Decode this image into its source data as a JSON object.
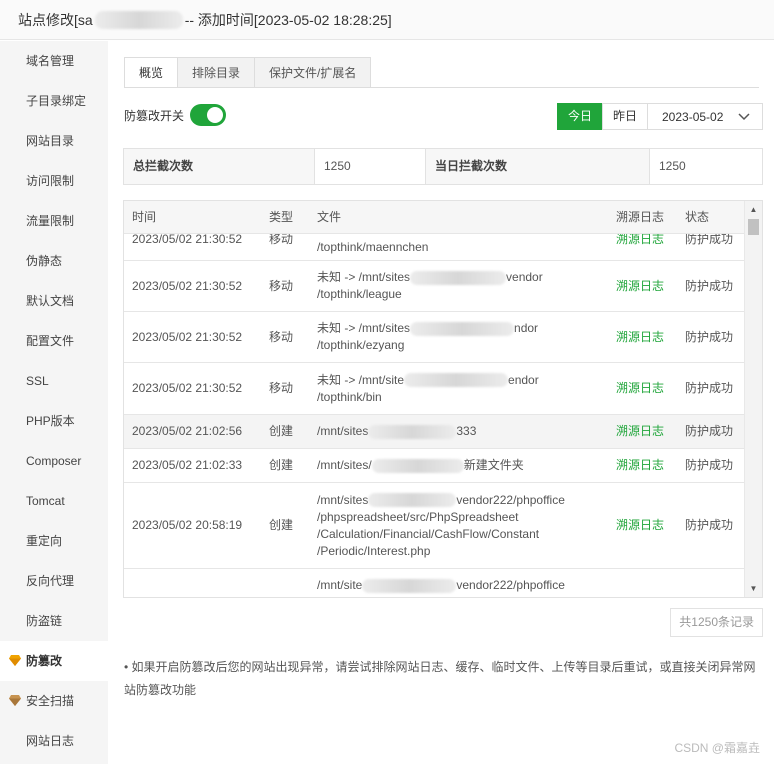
{
  "titlebar": {
    "prefix": "站点修改[sa",
    "suffix": "-- 添加时间[2023-05-02 18:28:25]"
  },
  "sidebar": {
    "items": [
      {
        "label": "域名管理"
      },
      {
        "label": "子目录绑定"
      },
      {
        "label": "网站目录"
      },
      {
        "label": "访问限制"
      },
      {
        "label": "流量限制"
      },
      {
        "label": "伪静态"
      },
      {
        "label": "默认文档"
      },
      {
        "label": "配置文件"
      },
      {
        "label": "SSL"
      },
      {
        "label": "PHP版本"
      },
      {
        "label": "Composer"
      },
      {
        "label": "Tomcat"
      },
      {
        "label": "重定向"
      },
      {
        "label": "反向代理"
      },
      {
        "label": "防盗链"
      },
      {
        "label": "防篡改"
      },
      {
        "label": "安全扫描"
      },
      {
        "label": "网站日志"
      }
    ],
    "active_label": "防篡改"
  },
  "tabs": [
    {
      "label": "概览"
    },
    {
      "label": "排除目录"
    },
    {
      "label": "保护文件/扩展名"
    }
  ],
  "toggle": {
    "label": "防篡改开关",
    "on": true
  },
  "datebar": {
    "today": "今日",
    "yesterday": "昨日",
    "date": "2023-05-02"
  },
  "stats": {
    "total_label": "总拦截次数",
    "total_value": "1250",
    "today_label": "当日拦截次数",
    "today_value": "1250"
  },
  "table": {
    "headers": {
      "time": "时间",
      "type": "类型",
      "file": "文件",
      "log": "溯源日志",
      "status": "状态"
    },
    "rows": [
      {
        "time": "2023/05/02 21:30:52",
        "type": "移动",
        "file": [
          "/topthink/maennchen"
        ],
        "log": "溯源日志",
        "status": "防护成功"
      },
      {
        "time": "2023/05/02 21:30:52",
        "type": "移动",
        "file": [
          "未知 -> /mnt/sites",
          "vendor",
          "/topthink/league"
        ],
        "log": "溯源日志",
        "status": "防护成功"
      },
      {
        "time": "2023/05/02 21:30:52",
        "type": "移动",
        "file": [
          "未知 -> /mnt/sites",
          "ndor",
          "/topthink/ezyang"
        ],
        "log": "溯源日志",
        "status": "防护成功"
      },
      {
        "time": "2023/05/02 21:30:52",
        "type": "移动",
        "file": [
          "未知 -> /mnt/site",
          "endor",
          "/topthink/bin"
        ],
        "log": "溯源日志",
        "status": "防护成功"
      },
      {
        "time": "2023/05/02 21:02:56",
        "type": "创建",
        "file": [
          "/mnt/sites",
          "333"
        ],
        "log": "溯源日志",
        "status": "防护成功"
      },
      {
        "time": "2023/05/02 21:02:33",
        "type": "创建",
        "file": [
          "/mnt/sites/",
          "新建文件夹"
        ],
        "log": "溯源日志",
        "status": "防护成功"
      },
      {
        "time": "2023/05/02 20:58:19",
        "type": "创建",
        "file": [
          "/mnt/sites",
          "vendor222/phpoffice",
          "/phpspreadsheet/src/PhpSpreadsheet",
          "/Calculation/Financial/CashFlow/Constant",
          "/Periodic/Interest.php"
        ],
        "log": "溯源日志",
        "status": "防护成功"
      },
      {
        "time": "",
        "type": "",
        "file": [
          "/mnt/site",
          "vendor222/phpoffice"
        ],
        "log": "",
        "status": ""
      }
    ]
  },
  "pager": "共1250条记录",
  "note": "• 如果开启防篡改后您的网站出现异常，请尝试排除网站日志、缓存、临时文件、上传等目录后重试，或直接关闭异常网站防篡改功能",
  "watermark": "CSDN @霜嘉垚",
  "colors": {
    "accent": "#20a53a",
    "gem": "#f0a300",
    "gem2": "#b07a3a"
  }
}
